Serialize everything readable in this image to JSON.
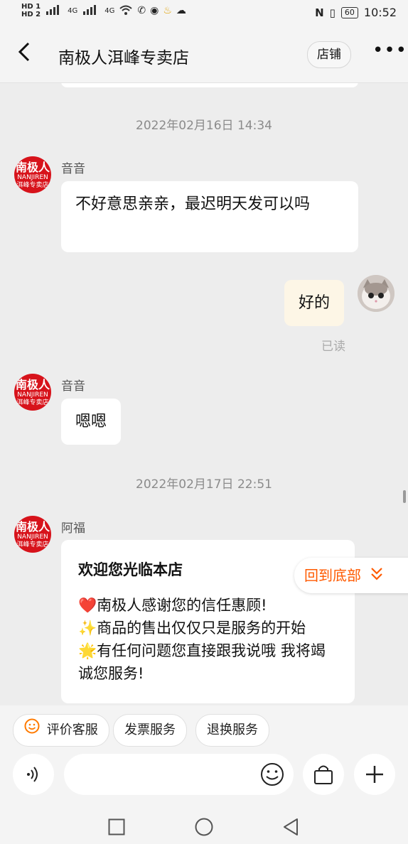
{
  "status": {
    "sim1": "HD 1",
    "sim2": "HD 2",
    "net1": "4G",
    "net2": "4G",
    "battery": "60",
    "time": "10:52"
  },
  "header": {
    "title": "南极人洱峰专卖店",
    "shop_button": "店铺",
    "more": "•••"
  },
  "chat": {
    "ts1": "2022年02月16日 14:34",
    "ts2": "2022年02月17日 22:51",
    "store_logo": {
      "line1": "南极人",
      "line2": "NANJIREN",
      "line3": "洱峰专卖店"
    },
    "m1": {
      "sender": "音音",
      "text": "不好意思亲亲，最迟明天发可以吗"
    },
    "m2": {
      "text": "好的",
      "status": "已读"
    },
    "m3": {
      "sender": "音音",
      "text": "嗯嗯"
    },
    "m4": {
      "sender": "阿福",
      "title": "欢迎您光临本店",
      "line1": "❤️南极人感谢您的信任惠顾!",
      "line2": "✨商品的售出仅仅只是服务的开始",
      "line3": "🌟有任何问题您直接跟我说哦 我将竭诚您服务!"
    },
    "to_bottom": "回到底部"
  },
  "quick_actions": [
    "评价客服",
    "发票服务",
    "退换服务"
  ],
  "icons": {
    "voice": "voice-icon",
    "emoji": "emoji-icon",
    "shop": "shopping-bag-icon",
    "plus": "plus-icon"
  },
  "colors": {
    "accent": "#ff5a00",
    "brand": "#d7131b",
    "my_bubble": "#fdf6e6"
  }
}
